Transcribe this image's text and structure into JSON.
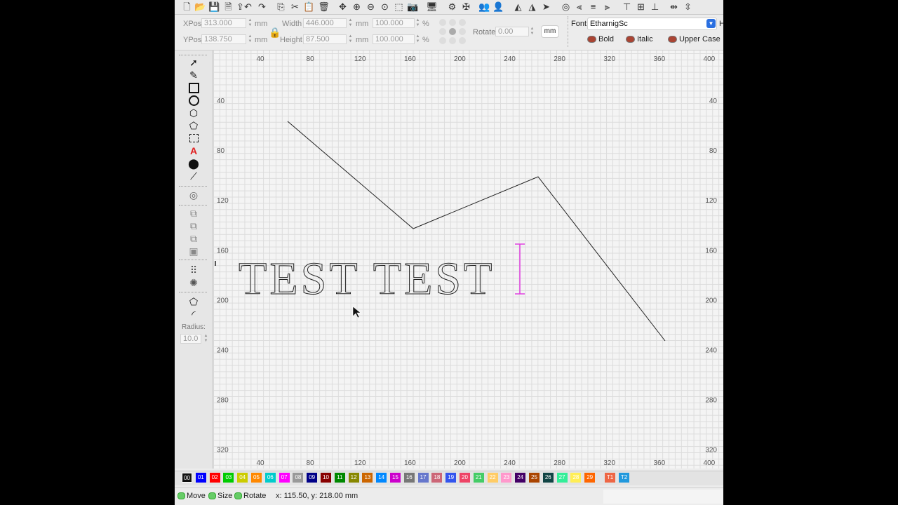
{
  "colors": {
    "accent": "#e040e0",
    "canvas_bg": "#f4f4f4",
    "grid": "#dcdcdc"
  },
  "toolbar": {
    "icons": [
      "new-file-icon",
      "open-folder-icon",
      "save-icon",
      "save-as-icon",
      "export-icon",
      "undo-icon",
      "redo-icon",
      "copy-icon",
      "cut-icon",
      "paste-icon",
      "delete-icon",
      "move-icon",
      "zoom-in-icon",
      "zoom-out-icon",
      "zoom-fit-icon",
      "zoom-window-icon",
      "camera-icon",
      "monitor-icon",
      "settings-icon",
      "tools-icon",
      "users-icon",
      "user-icon",
      "mirror-h-icon",
      "mirror-v-icon",
      "send-icon",
      "target-icon",
      "align-left-icon",
      "align-center-icon",
      "align-right-icon",
      "align-top-icon",
      "align-middle-icon",
      "align-bottom-icon",
      "distribute-h-icon",
      "distribute-v-icon"
    ]
  },
  "props": {
    "xpos_label": "XPos",
    "xpos_value": "313.000",
    "ypos_label": "YPos",
    "ypos_value": "138.750",
    "unit_mm": "mm",
    "width_label": "Width",
    "width_value": "446.000",
    "height_label": "Height",
    "height_value": "87.500",
    "width_pct": "100.000",
    "height_pct": "100.000",
    "pct": "%",
    "rotate_label": "Rotate",
    "rotate_value": "0.00",
    "unit_button": "mm",
    "font_label": "Font",
    "font_value": "EtharnigSc",
    "font_extra": "H",
    "bold": "Bold",
    "italic": "Italic",
    "upper_case": "Upper Case"
  },
  "left_tools": {
    "radius_label": "Radius:",
    "radius_value": "10.0"
  },
  "rulers": {
    "top": [
      "40",
      "80",
      "120",
      "160",
      "200",
      "240",
      "280",
      "320",
      "360",
      "400"
    ],
    "left": [
      "40",
      "80",
      "120",
      "160",
      "200",
      "240",
      "280",
      "320"
    ]
  },
  "canvas": {
    "text": "TEST TEST"
  },
  "palette": [
    "00",
    "01",
    "02",
    "03",
    "04",
    "05",
    "06",
    "07",
    "08",
    "09",
    "10",
    "11",
    "12",
    "13",
    "14",
    "15",
    "16",
    "17",
    "18",
    "19",
    "20",
    "21",
    "22",
    "23",
    "24",
    "25",
    "26",
    "27",
    "28",
    "29",
    "T1",
    "T2"
  ],
  "palette_colors": [
    "#111111",
    "#0000ff",
    "#ff0000",
    "#00cc00",
    "#cccc00",
    "#ff8800",
    "#00cccc",
    "#ff00ff",
    "#999999",
    "#000088",
    "#880000",
    "#008800",
    "#888800",
    "#cc6600",
    "#0088ff",
    "#cc00cc",
    "#777777",
    "#6677cc",
    "#cc6677",
    "#3355ee",
    "#ee4466",
    "#44cc66",
    "#ffcc66",
    "#ff99cc",
    "#440066",
    "#aa4400",
    "#114444",
    "#33ee99",
    "#ffee55",
    "#ff6600",
    "#ee6644",
    "#2299dd"
  ],
  "status": {
    "move": "Move",
    "size": "Size",
    "rotate": "Rotate",
    "coords": "x: 115.50, y: 218.00 mm"
  }
}
